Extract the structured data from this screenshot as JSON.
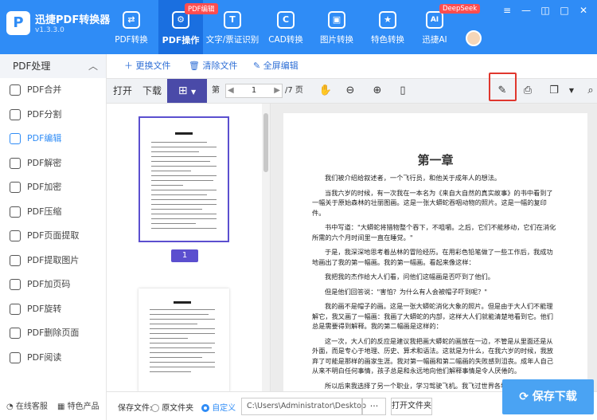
{
  "app": {
    "name": "迅捷PDF转换器",
    "version": "v1.3.3.0",
    "logo_letter": "P"
  },
  "nav": [
    {
      "label": "PDF转换",
      "icon": "swap-icon",
      "glyph": "⇄"
    },
    {
      "label": "PDF操作",
      "icon": "gear-icon",
      "glyph": "⚙",
      "badge": "PDF编辑"
    },
    {
      "label": "文字/票证识别",
      "icon": "scan-text-icon",
      "glyph": "T"
    },
    {
      "label": "CAD转换",
      "icon": "cad-icon",
      "glyph": "C"
    },
    {
      "label": "图片转换",
      "icon": "image-icon",
      "glyph": "▣"
    },
    {
      "label": "特色转换",
      "icon": "star-icon",
      "glyph": "★"
    },
    {
      "label": "迅捷AI",
      "icon": "ai-icon",
      "glyph": "AI",
      "badge": "DeepSeek"
    }
  ],
  "sidebar": {
    "header": "PDF处理",
    "items": [
      {
        "label": "PDF合并",
        "icon": "merge-icon"
      },
      {
        "label": "PDF分割",
        "icon": "split-icon"
      },
      {
        "label": "PDF编辑",
        "icon": "edit-icon"
      },
      {
        "label": "PDF解密",
        "icon": "unlock-icon"
      },
      {
        "label": "PDF加密",
        "icon": "shield-icon"
      },
      {
        "label": "PDF压缩",
        "icon": "compress-icon"
      },
      {
        "label": "PDF页面提取",
        "icon": "page-extract-icon"
      },
      {
        "label": "PDF提取图片",
        "icon": "image-extract-icon"
      },
      {
        "label": "PDF加页码",
        "icon": "page-number-icon"
      },
      {
        "label": "PDF旋转",
        "icon": "rotate-icon"
      },
      {
        "label": "PDF删除页面",
        "icon": "delete-page-icon"
      },
      {
        "label": "PDF阅读",
        "icon": "read-icon"
      }
    ],
    "footer_service": "在线客服",
    "footer_products": "特色产品"
  },
  "subbar": {
    "replace": "更换文件",
    "clear": "清除文件",
    "fullscreen": "全屏编辑"
  },
  "toolbar": {
    "open": "打开",
    "download": "下载",
    "page_label": "第",
    "page_value": "1",
    "page_total": "/7 页"
  },
  "thumbs": {
    "page_number": "1"
  },
  "document": {
    "chapter": "第一章",
    "paragraphs": [
      "我们被介绍给叙述者，一个飞行员，和他关于成年人的想法。",
      "当我六岁的时候，有一次我在一本名为《来自大自然的真实故事》的书中看到了一幅关于原始森林的壮丽图画。这是一张大蟒蛇吞咽动物的照片。这是一幅的复印件。",
      "书中写道：\"大蟒蛇将猎物整个吞下，不咀嚼。之后，它们不能移动，它们在消化所需的六个月时间里一直在睡觉。\"",
      "于是，我深深地思考着丛林的冒险经历。在用彩色铅笔做了一些工作后，我成功地画出了我的第一幅画。我的第一幅画。看起来像这样：",
      "我把我的杰作给大人们看，问他们这幅画是否吓到了他们。",
      "但是他们回答说：\"害怕？为什么有人会被帽子吓到呢？\"",
      "我的画不是帽子的画。这是一张大蟒蛇消化大象的照片。但是由于大人们不能理解它，我又画了一幅画：我画了大蟒蛇的内部，这样大人们就能清楚地看到它。他们总是需要得到解释。我的第二幅画是这样的：",
      "这一次，大人们的反应是建议我把画大蟒蛇的画放在一边，不管是从里面还是从外面，而是专心于地理、历史、算术和语法。这就是为什么，在我六岁的时候，我放弃了可能是那样的画家生涯。我对第一幅画和第二幅画的失败感到沮丧。成年人自己从来不明白任何事情，孩子总是和永远地向他们解释事情是令人厌倦的。",
      "所以后来我选择了另一个职业，学习驾驶飞机。我飞过世界各地一点，的确，"
    ]
  },
  "bottom": {
    "save_label": "保存文件:",
    "opt_original": "原文件夹",
    "opt_custom": "自定义",
    "path": "C:\\Users\\Administrator\\Desktop",
    "browse": "···",
    "open_folder": "打开文件夹",
    "save_button": "保存下载"
  },
  "colors": {
    "accent": "#2f8cf6",
    "highlight": "#e0372e",
    "selection": "#5b4fcf"
  }
}
